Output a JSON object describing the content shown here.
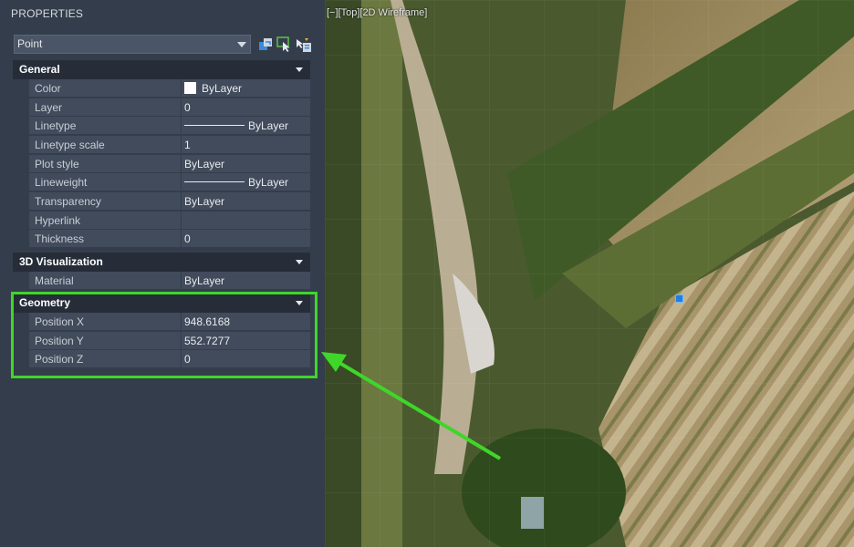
{
  "panel": {
    "title": "PROPERTIES",
    "object_type": "Point",
    "tools": [
      "toggle-pickadd-icon",
      "select-objects-icon",
      "quick-select-icon"
    ]
  },
  "sections": {
    "general": {
      "title": "General",
      "rows": [
        {
          "name": "Color",
          "value": "ByLayer"
        },
        {
          "name": "Layer",
          "value": "0"
        },
        {
          "name": "Linetype",
          "value": "ByLayer"
        },
        {
          "name": "Linetype scale",
          "value": "1"
        },
        {
          "name": "Plot style",
          "value": "ByLayer"
        },
        {
          "name": "Lineweight",
          "value": "ByLayer"
        },
        {
          "name": "Transparency",
          "value": "ByLayer"
        },
        {
          "name": "Hyperlink",
          "value": ""
        },
        {
          "name": "Thickness",
          "value": "0"
        }
      ]
    },
    "visualization": {
      "title": "3D Visualization",
      "rows": [
        {
          "name": "Material",
          "value": "ByLayer"
        }
      ]
    },
    "geometry": {
      "title": "Geometry",
      "rows": [
        {
          "name": "Position X",
          "value": "948.6168"
        },
        {
          "name": "Position Y",
          "value": "552.7277"
        },
        {
          "name": "Position Z",
          "value": "0"
        }
      ]
    }
  },
  "viewport": {
    "label": "[−][Top][2D Wireframe]"
  },
  "colors": {
    "highlight": "#3fd62a",
    "marker": "#1f7ee0",
    "panel_bg": "#343d4b"
  }
}
